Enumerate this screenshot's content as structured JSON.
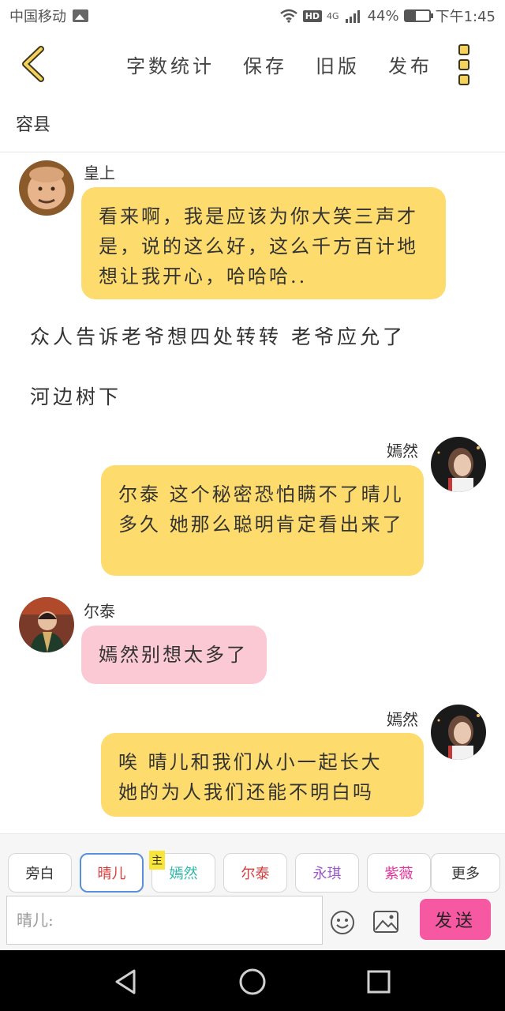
{
  "status_bar": {
    "carrier": "中国移动",
    "network": "4G",
    "hd": "HD",
    "battery": "44%",
    "time": "下午1:45"
  },
  "header": {
    "actions": [
      "字数统计",
      "保存",
      "旧版",
      "发布"
    ]
  },
  "title": "容县",
  "messages": [
    {
      "kind": "left",
      "name": "皇上",
      "text": "看来啊，我是应该为你大笑三声才是，说的这么好，这么千方百计地想让我开心，哈哈哈..",
      "color": "#fddb6d"
    },
    {
      "kind": "narration",
      "text": "众人告诉老爷想四处转转 老爷应允了"
    },
    {
      "kind": "narration",
      "text": "河边树下"
    },
    {
      "kind": "right",
      "name": "嫣然",
      "text": "尔泰 这个秘密恐怕瞒不了晴儿多久 她那么聪明肯定看出来了",
      "color": "#fddb6d"
    },
    {
      "kind": "left",
      "name": "尔泰",
      "text": "嫣然别想太多了",
      "color": "#fbc9d4"
    },
    {
      "kind": "right",
      "name": "嫣然",
      "text": "唉 晴儿和我们从小一起长大 她的为人我们还能不明白吗",
      "color": "#fddb6d"
    }
  ],
  "input": {
    "roles": [
      {
        "label": "旁白",
        "color": "#333333"
      },
      {
        "label": "晴儿",
        "color": "#d93b3b"
      },
      {
        "label": "嫣然",
        "color": "#2fb7a6",
        "tag": "主"
      },
      {
        "label": "尔泰",
        "color": "#d93b3b"
      },
      {
        "label": "永琪",
        "color": "#9b59c9"
      },
      {
        "label": "紫薇",
        "color": "#e0359a"
      },
      {
        "label": "更多",
        "color": "#333333"
      }
    ],
    "placeholder": "晴儿:",
    "send_label": "发送"
  }
}
